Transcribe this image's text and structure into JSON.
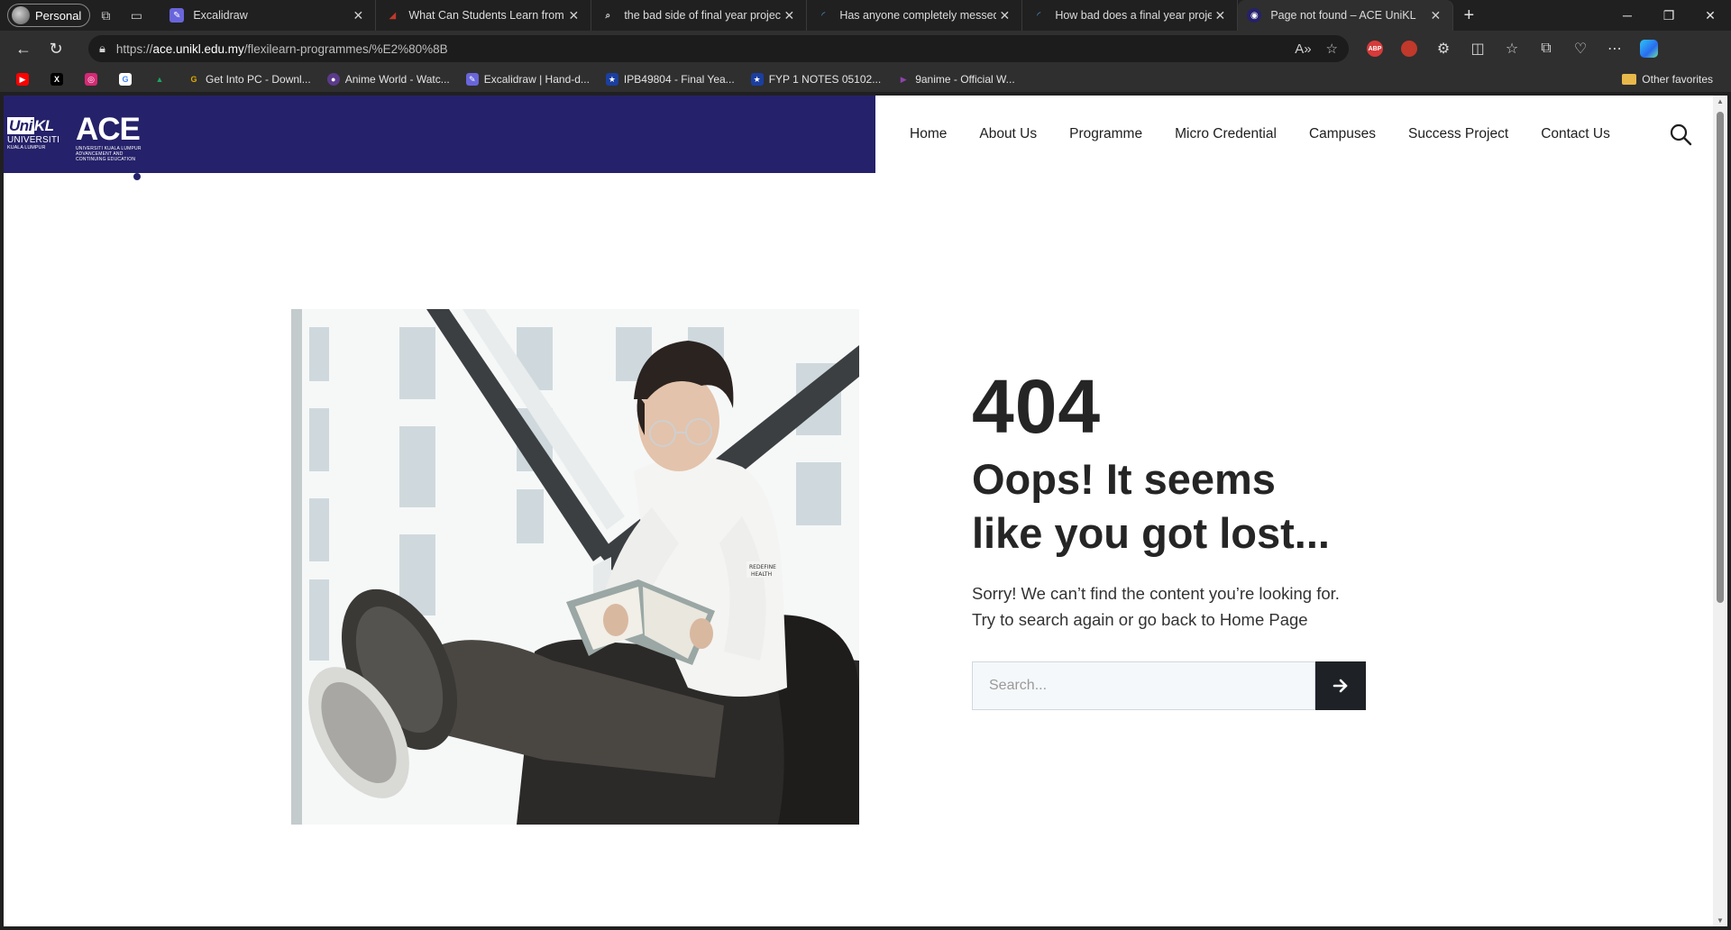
{
  "browser": {
    "profile_label": "Personal",
    "tabs": [
      {
        "title": "Excalidraw",
        "favicon": "excalidraw-icon",
        "active": false
      },
      {
        "title": "What Can Students Learn from Fi",
        "favicon": "article-icon",
        "active": false
      },
      {
        "title": "the bad side of final year project",
        "favicon": "search-icon",
        "active": false
      },
      {
        "title": "Has anyone completely messed u",
        "favicon": "loading-icon",
        "active": false
      },
      {
        "title": "How bad does a final year projec",
        "favicon": "loading-icon",
        "active": false
      },
      {
        "title": "Page not found – ACE UniKL",
        "favicon": "ace-icon",
        "active": true
      }
    ],
    "url": {
      "prefix": "https://",
      "host": "ace.unikl.edu.my",
      "path": "/flexilearn-programmes/%E2%80%8B"
    },
    "bookmarks": [
      {
        "label": "",
        "icon": "youtube-icon",
        "color": "#ff0000"
      },
      {
        "label": "",
        "icon": "x-icon",
        "color": "#000000"
      },
      {
        "label": "",
        "icon": "instagram-icon",
        "color": "#d62976"
      },
      {
        "label": "",
        "icon": "google-icon",
        "color": "#4285f4"
      },
      {
        "label": "",
        "icon": "drive-icon",
        "color": "#1fa463"
      },
      {
        "label": "Get Into PC - Downl...",
        "icon": "getintopc-icon",
        "color": "#e0a800"
      },
      {
        "label": "Anime World - Watc...",
        "icon": "animeworld-icon",
        "color": "#5b3a8a"
      },
      {
        "label": "Excalidraw | Hand-d...",
        "icon": "excalidraw-icon",
        "color": "#6965db"
      },
      {
        "label": "IPB49804 - Final Yea...",
        "icon": "star-icon",
        "color": "#1a3fa0"
      },
      {
        "label": "FYP 1 NOTES 05102...",
        "icon": "star-icon",
        "color": "#1a3fa0"
      },
      {
        "label": "9anime - Official W...",
        "icon": "play-icon",
        "color": "#8e44ad"
      }
    ],
    "other_favorites": "Other favorites"
  },
  "site": {
    "brand": {
      "unikl_top": "KL",
      "unikl_uni": "Uni",
      "unikl_line2": "UNIVERSITI",
      "unikl_line3": "KUALA LUMPUR",
      "ace": "ACE",
      "ace_sub1": "UNIVERSITI KUALA LUMPUR",
      "ace_sub2": "ADVANCEMENT AND",
      "ace_sub3": "CONTINUING EDUCATION"
    },
    "nav": [
      "Home",
      "About Us",
      "Programme",
      "Micro Credential",
      "Campuses",
      "Success Project",
      "Contact Us"
    ],
    "error": {
      "code": "404",
      "headline": "Oops! It seems like you got lost...",
      "line1": "Sorry! We can’t find the content you’re looking for.",
      "line2": "Try to search again or go back to Home Page"
    },
    "search": {
      "placeholder": "Search...",
      "value": ""
    },
    "colors": {
      "brand": "#25216a",
      "text": "#252525",
      "button": "#1e2227"
    }
  }
}
